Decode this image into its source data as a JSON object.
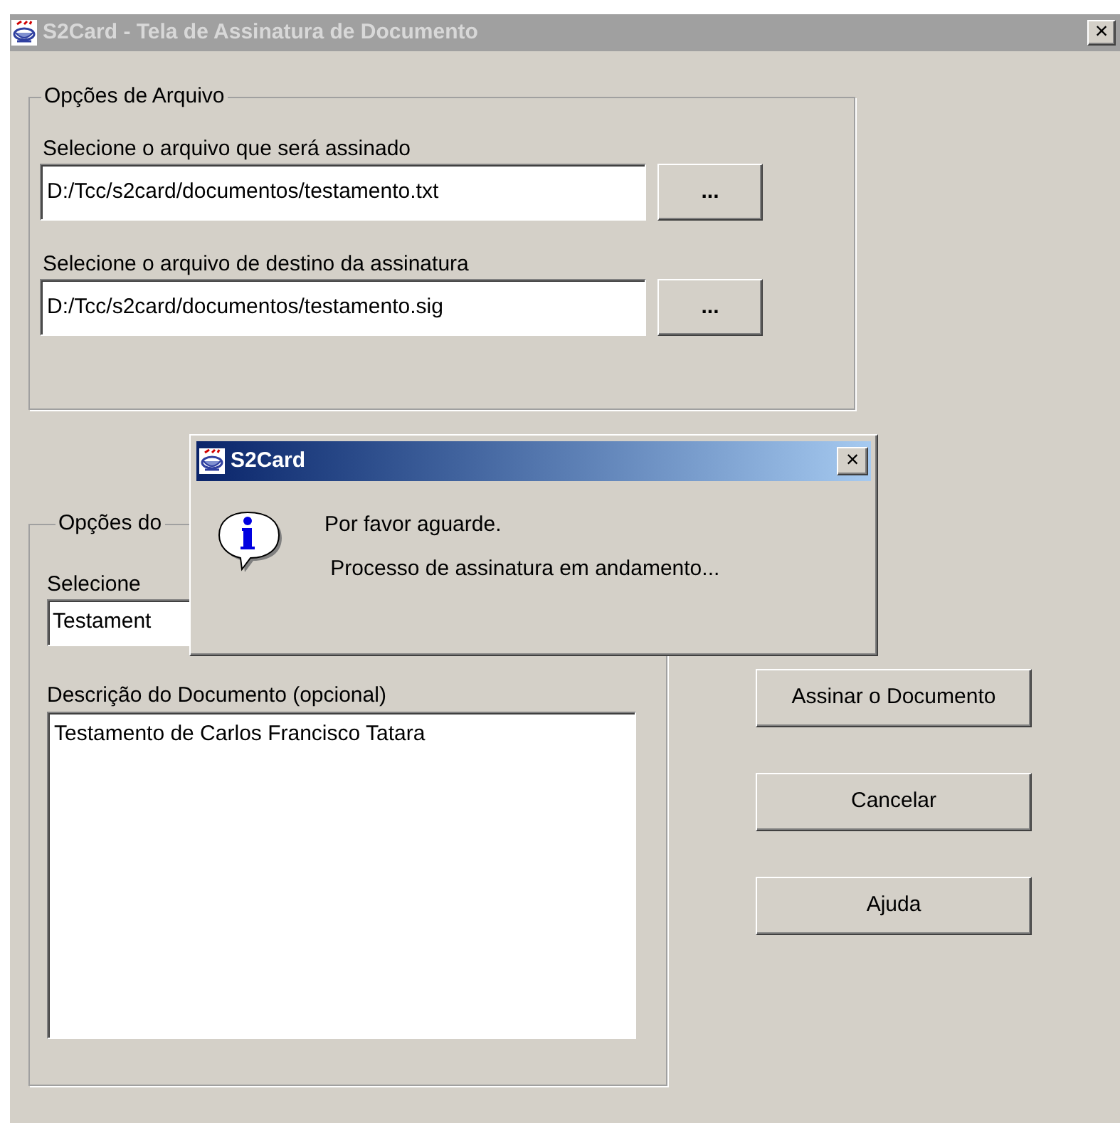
{
  "window": {
    "title": "S2Card - Tela de Assinatura de Documento",
    "close": "×"
  },
  "file_options": {
    "legend": "Opções de Arquivo",
    "fields": [
      {
        "label": "Selecione o arquivo que será assinado",
        "value": "D:/Tcc/s2card/documentos/testamento.txt",
        "browse": "..."
      },
      {
        "label": "Selecione o arquivo de destino da assinatura",
        "value": "D:/Tcc/s2card/documentos/testamento.sig",
        "browse": "..."
      }
    ]
  },
  "document_options": {
    "legend": "Opções do",
    "select_label": "Selecione",
    "select_value": "Testament",
    "description_label": "Descrição do Documento (opcional)",
    "description_value": "Testamento de Carlos Francisco Tatara"
  },
  "buttons": [
    "Assinar o Documento",
    "Cancelar",
    "Ajuda"
  ],
  "dialog": {
    "title": "S2Card",
    "close": "×",
    "lines": [
      "Por favor aguarde.",
      " Processo de assinatura em andamento..."
    ]
  }
}
